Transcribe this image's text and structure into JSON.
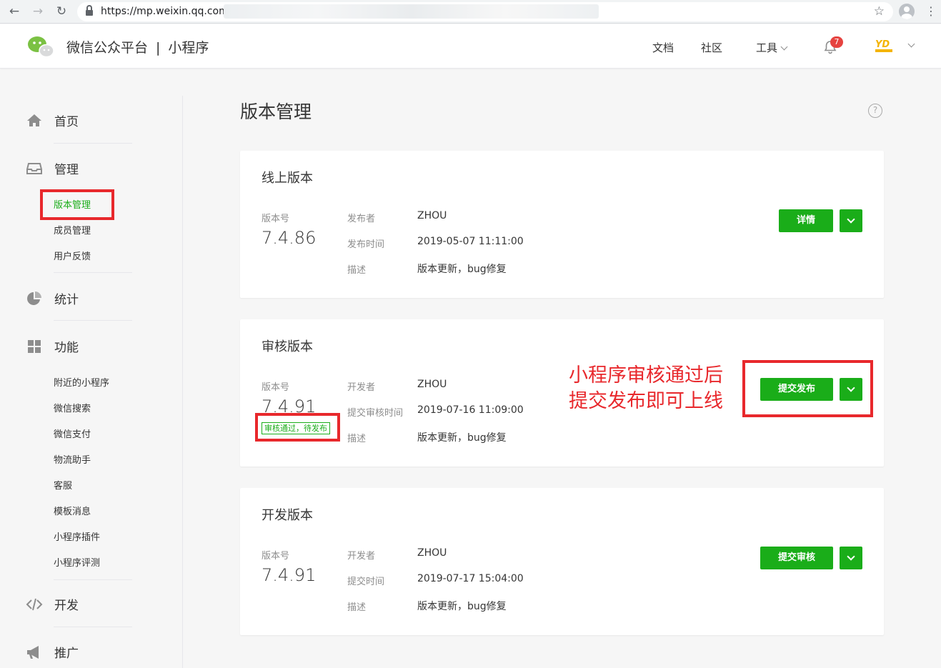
{
  "browser": {
    "url": "https://mp.weixin.qq.com"
  },
  "header": {
    "brand": "微信公众平台",
    "separator": "|",
    "product": "小程序",
    "nav": [
      "文档",
      "社区",
      "工具"
    ],
    "notification_count": "7"
  },
  "sidebar": {
    "sections": [
      {
        "label": "首页",
        "icon": "home-icon"
      },
      {
        "label": "管理",
        "icon": "inbox-icon"
      },
      {
        "label": "统计",
        "icon": "pie-chart-icon"
      },
      {
        "label": "功能",
        "icon": "grid-icon"
      },
      {
        "label": "开发",
        "icon": "code-icon"
      },
      {
        "label": "推广",
        "icon": "megaphone-icon"
      }
    ],
    "manage_items": [
      "版本管理",
      "成员管理",
      "用户反馈"
    ],
    "feature_items": [
      "附近的小程序",
      "微信搜索",
      "微信支付",
      "物流助手",
      "客服",
      "模板消息",
      "小程序插件",
      "小程序评测"
    ]
  },
  "main": {
    "title": "版本管理",
    "help": "?",
    "online": {
      "title": "线上版本",
      "version_label": "版本号",
      "version": "7.4.86",
      "fields": [
        {
          "key": "发布者",
          "value": "ZHOU"
        },
        {
          "key": "发布时间",
          "value": "2019-05-07 11:11:00"
        },
        {
          "key": "描述",
          "value": "版本更新，bug修复"
        }
      ],
      "button": "详情"
    },
    "review": {
      "title": "审核版本",
      "version_label": "版本号",
      "version": "7.4.91",
      "status": "审核通过，待发布",
      "fields": [
        {
          "key": "开发者",
          "value": "ZHOU"
        },
        {
          "key": "提交审核时间",
          "value": "2019-07-16 11:09:00"
        },
        {
          "key": "描述",
          "value": "版本更新，bug修复"
        }
      ],
      "button": "提交发布"
    },
    "dev": {
      "title": "开发版本",
      "version_label": "版本号",
      "version": "7.4.91",
      "fields": [
        {
          "key": "开发者",
          "value": "ZHOU"
        },
        {
          "key": "提交时间",
          "value": "2019-07-17 15:04:00"
        },
        {
          "key": "描述",
          "value": "版本更新，bug修复"
        }
      ],
      "button": "提交审核"
    }
  },
  "annotation": {
    "line1": "小程序审核通过后",
    "line2": "提交发布即可上线",
    "color": "#e8282c"
  },
  "colors": {
    "accent": "#1aad19",
    "badge": "#e64340"
  }
}
